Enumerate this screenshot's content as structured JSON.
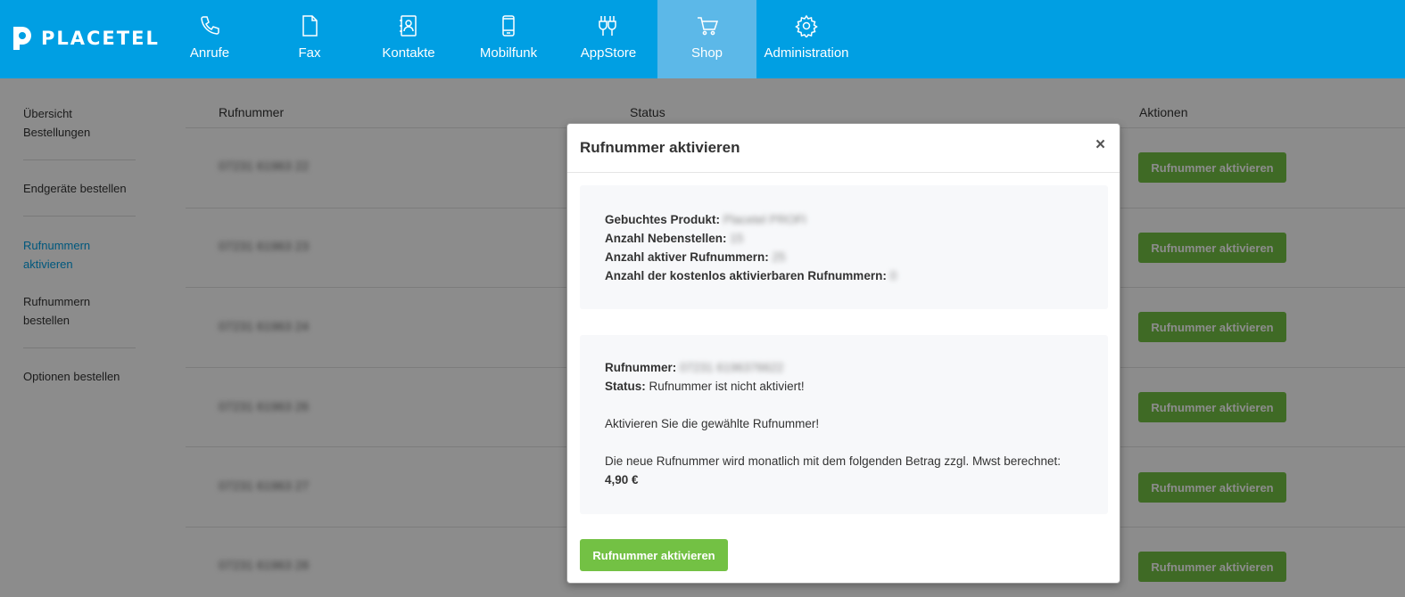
{
  "brand": {
    "name": "PLACETEL"
  },
  "nav": [
    {
      "label": "Anrufe",
      "icon": "phone-icon"
    },
    {
      "label": "Fax",
      "icon": "document-icon"
    },
    {
      "label": "Kontakte",
      "icon": "contacts-icon"
    },
    {
      "label": "Mobilfunk",
      "icon": "mobile-icon"
    },
    {
      "label": "AppStore",
      "icon": "apps-icon"
    },
    {
      "label": "Shop",
      "icon": "cart-icon",
      "active": true
    },
    {
      "label": "Administration",
      "icon": "gear-icon"
    }
  ],
  "sidebar": {
    "items": [
      {
        "label": "Übersicht Bestellungen"
      },
      {
        "label": "Endgeräte bestellen"
      },
      {
        "label": "Rufnummern aktivieren",
        "active": true
      },
      {
        "label": "Rufnummern bestellen"
      },
      {
        "label": "Optionen bestellen"
      }
    ]
  },
  "table": {
    "headers": {
      "number": "Rufnummer",
      "status": "Status",
      "actions": "Aktionen"
    },
    "rows": [
      {
        "number": "07231 61963 22",
        "action": "Rufnummer aktivieren"
      },
      {
        "number": "07231 61963 23",
        "action": "Rufnummer aktivieren"
      },
      {
        "number": "07231 61963 24",
        "action": "Rufnummer aktivieren"
      },
      {
        "number": "07231 61963 26",
        "action": "Rufnummer aktivieren"
      },
      {
        "number": "07231 61963 27",
        "action": "Rufnummer aktivieren"
      },
      {
        "number": "07231 61963 28",
        "action": "Rufnummer aktivieren"
      }
    ]
  },
  "modal": {
    "title": "Rufnummer aktivieren",
    "close": "×",
    "summary": {
      "product_label": "Gebuchtes Produkt:",
      "product_value": "Placetel PROFI",
      "extensions_label": "Anzahl Nebenstellen:",
      "extensions_value": "15",
      "active_label": "Anzahl aktiver Rufnummern:",
      "active_value": "25",
      "free_label": "Anzahl der kostenlos aktivierbaren Rufnummern:",
      "free_value": "0"
    },
    "details": {
      "number_label": "Rufnummer:",
      "number_value": "07231 6196376622",
      "status_label": "Status:",
      "status_value": "Rufnummer ist nicht aktiviert!",
      "prompt": "Aktivieren Sie die gewählte Rufnummer!",
      "price_note": "Die neue Rufnummer wird monatlich mit dem folgenden Betrag zzgl. Mwst berechnet:",
      "price": "4,90 €"
    },
    "submit": "Rufnummer aktivieren"
  },
  "colors": {
    "brand": "#009fe3",
    "nav_active": "#5cb8e8",
    "button": "#73c144"
  }
}
